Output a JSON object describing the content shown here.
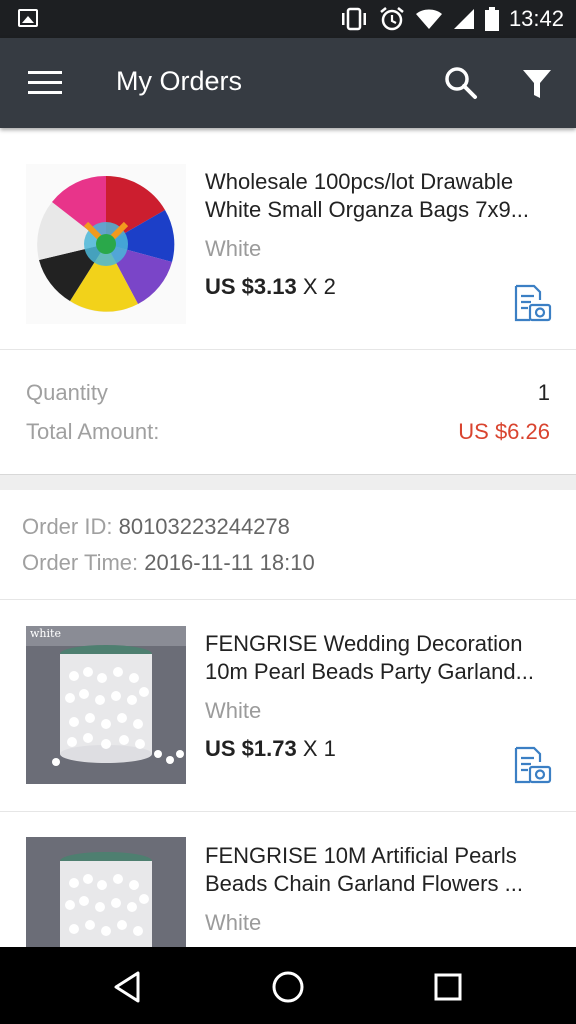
{
  "status_bar": {
    "time": "13:42",
    "icons": [
      "image-icon",
      "vibrate-icon",
      "alarm-icon",
      "wifi-icon",
      "signal-icon",
      "battery-icon"
    ]
  },
  "app_bar": {
    "title": "My Orders",
    "icons": [
      "menu-icon",
      "search-icon",
      "filter-icon"
    ]
  },
  "orders": [
    {
      "products": [
        {
          "name_line1": "Wholesale 100pcs/lot Drawable",
          "name_line2": "White Small Organza Bags 7x9...",
          "variant": "White",
          "price": "US $3.13",
          "qty": "X 2"
        }
      ],
      "summary": {
        "quantity_label": "Quantity",
        "quantity_value": "1",
        "total_label": "Total Amount:",
        "total_value": "US $6.26"
      }
    },
    {
      "order_id_label": "Order ID:",
      "order_id": "80103223244278",
      "order_time_label": "Order Time:",
      "order_time": "2016-11-11 18:10",
      "products": [
        {
          "name_line1": "FENGRISE Wedding Decoration",
          "name_line2": "10m Pearl Beads Party Garland...",
          "variant": "White",
          "price": "US $1.73",
          "qty": "X 1",
          "thumb_label": "white"
        },
        {
          "name_line1": "FENGRISE 10M Artificial Pearls",
          "name_line2": "Beads Chain Garland Flowers ...",
          "variant": "White"
        }
      ]
    }
  ],
  "colors": {
    "status_bar": "#1d1f22",
    "app_bar": "#363b42",
    "total_amount": "#d9442f",
    "snapshot_icon": "#3b7fc4"
  },
  "nav_bar": {
    "icons": [
      "back-icon",
      "home-icon",
      "recents-icon"
    ]
  }
}
